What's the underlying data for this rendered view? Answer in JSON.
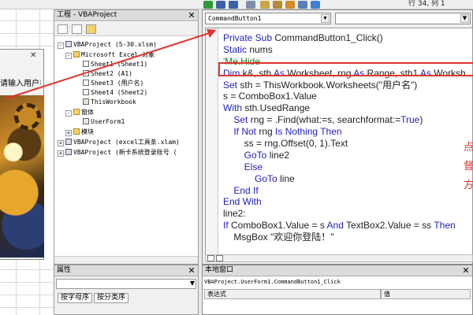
{
  "window": {
    "cursor_position": "行 34, 列 1"
  },
  "project_explorer": {
    "title": "工程 - VBAProject",
    "tree": [
      {
        "label": "VBAProject (5-30.xlsm)",
        "icon": "vba-project-icon"
      },
      {
        "label": "Microsoft Excel 对象",
        "icon": "folder-icon"
      },
      {
        "label": "Sheet1 (Sheet1)",
        "icon": "sheet-icon"
      },
      {
        "label": "Sheet2 (A1)",
        "icon": "sheet-icon"
      },
      {
        "label": "Sheet3 (用户名)",
        "icon": "sheet-icon"
      },
      {
        "label": "Sheet4 (Sheet2)",
        "icon": "sheet-icon"
      },
      {
        "label": "ThisWorkbook",
        "icon": "workbook-icon"
      },
      {
        "label": "窗体",
        "icon": "folder-icon"
      },
      {
        "label": "UserForm1",
        "icon": "form-icon"
      },
      {
        "label": "模块",
        "icon": "folder-icon"
      },
      {
        "label": "VBAProject (excel工具条.xlam)",
        "icon": "vba-project-icon"
      },
      {
        "label": "VBAProject (新卡系统登录账号 (",
        "icon": "vba-project-icon"
      }
    ]
  },
  "properties": {
    "title": "属性",
    "tabs": [
      "按字母序",
      "按分类序"
    ]
  },
  "userform": {
    "label": "请输入用户名"
  },
  "code_window": {
    "object_combo": "CommandButton1",
    "procedure_combo": "",
    "lines": [
      [
        [
          "kw",
          "Private Sub "
        ],
        [
          "pl",
          "CommandButton1_Click()"
        ]
      ],
      [
        [
          "kw",
          "Static "
        ],
        [
          "pl",
          "nums"
        ]
      ],
      [
        [
          "cm",
          "'Me.Hide"
        ]
      ],
      [
        [
          "kw",
          "Dim "
        ],
        [
          "pl",
          "k&, sth "
        ],
        [
          "kw",
          "As "
        ],
        [
          "pl",
          "Worksheet, rng "
        ],
        [
          "kw",
          "As "
        ],
        [
          "pl",
          "Range, sth1 "
        ],
        [
          "kw",
          "As "
        ],
        [
          "pl",
          "Worksh"
        ]
      ],
      [
        [
          "kw",
          "Set "
        ],
        [
          "pl",
          "sth = ThisWorkbook.Worksheets(\"用户名\")"
        ]
      ],
      [
        [
          "pl",
          "s = ComboBox1.Value"
        ]
      ],
      [
        [
          "kw",
          "With "
        ],
        [
          "pl",
          "sth.UsedRange"
        ]
      ],
      [
        [
          "pl",
          "    "
        ],
        [
          "kw",
          "Set "
        ],
        [
          "pl",
          "rng = .Find(what:=s, searchformat:="
        ],
        [
          "kw",
          "True"
        ],
        [
          "pl",
          ")"
        ]
      ],
      [
        [
          "pl",
          "    "
        ],
        [
          "kw",
          "If Not "
        ],
        [
          "pl",
          "rng "
        ],
        [
          "kw",
          "Is Nothing Then"
        ]
      ],
      [
        [
          "pl",
          "        ss = rng.Offset(0, 1).Text"
        ]
      ],
      [
        [
          "pl",
          "        "
        ],
        [
          "kw",
          "GoTo "
        ],
        [
          "pl",
          "line2"
        ]
      ],
      [
        [
          "pl",
          "        "
        ],
        [
          "kw",
          "Else"
        ]
      ],
      [
        [
          "pl",
          "            "
        ],
        [
          "kw",
          "GoTo "
        ],
        [
          "pl",
          "line"
        ]
      ],
      [
        [
          "pl",
          "    "
        ],
        [
          "kw",
          "End If"
        ]
      ],
      [
        [
          "kw",
          "End With"
        ]
      ],
      [
        [
          "pl",
          "line2:"
        ]
      ],
      [
        [
          "kw",
          "If "
        ],
        [
          "pl",
          "ComboBox1.Value = s "
        ],
        [
          "kw",
          "And "
        ],
        [
          "pl",
          "TextBox2.Value = ss "
        ],
        [
          "kw",
          "Then"
        ]
      ],
      [
        [
          "pl",
          "    MsgBox \"欢迎你登陆！\""
        ]
      ]
    ]
  },
  "annotation": {
    "text": "点督方",
    "color": "#e1322f"
  },
  "immediate": {
    "title": "本地窗口",
    "context": "VBAProject.UserForm1.CommandButton1_Click",
    "columns": [
      "表达式",
      "值"
    ]
  },
  "colors": {
    "keyword": "#1f1fb8",
    "comment": "#1a7a1a",
    "highlight_box": "#e1322f"
  }
}
